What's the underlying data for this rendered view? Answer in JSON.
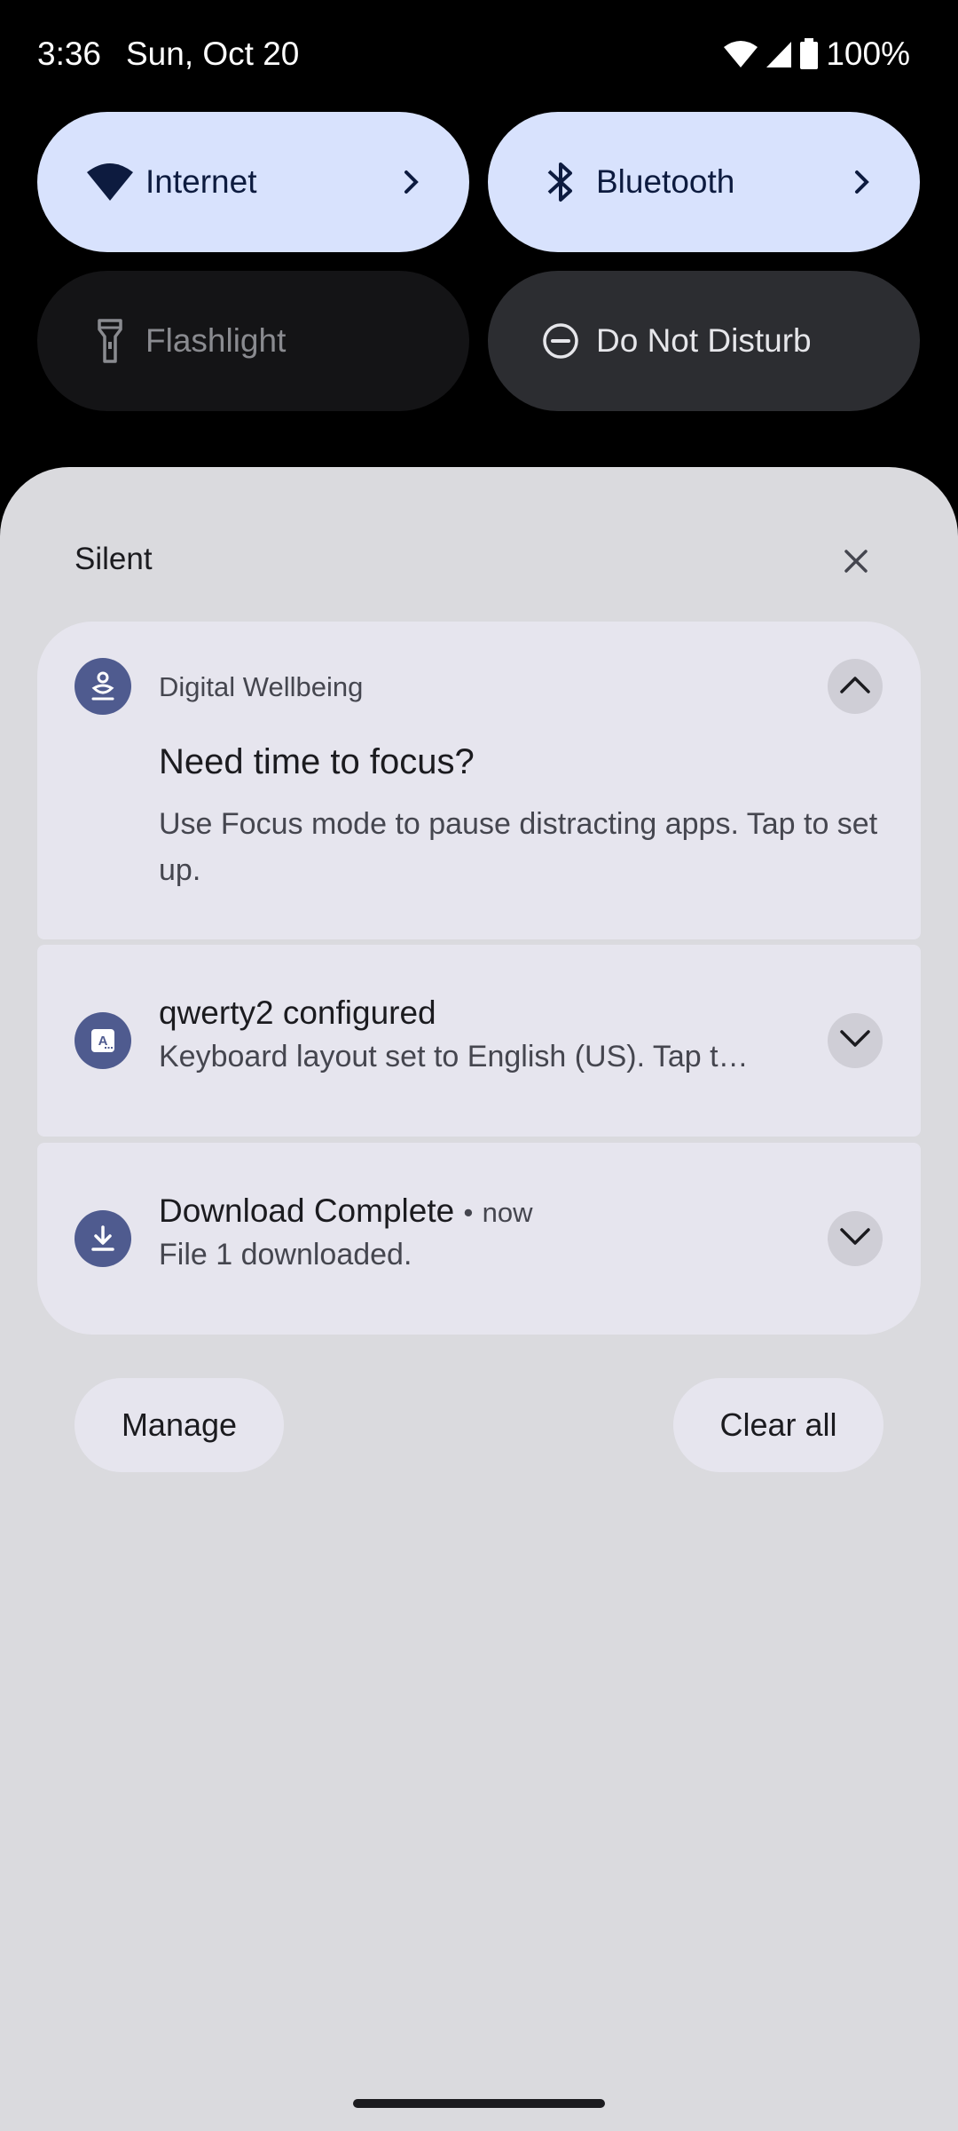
{
  "status_bar": {
    "time": "3:36",
    "date": "Sun, Oct 20",
    "battery": "100%"
  },
  "quick_tiles": [
    {
      "label": "Internet",
      "icon": "wifi-icon",
      "state": "on"
    },
    {
      "label": "Bluetooth",
      "icon": "bluetooth-icon",
      "state": "on"
    },
    {
      "label": "Flashlight",
      "icon": "flashlight-icon",
      "state": "unavailable"
    },
    {
      "label": "Do Not Disturb",
      "icon": "do-not-disturb-icon",
      "state": "off"
    }
  ],
  "shade": {
    "section_title": "Silent",
    "notifications": [
      {
        "app": "Digital Wellbeing",
        "icon": "wellbeing-icon",
        "title": "Need time to focus?",
        "text": "Use Focus mode to pause distracting apps. Tap to set up.",
        "expanded": true
      },
      {
        "title": "qwerty2 configured",
        "icon": "keyboard-icon",
        "text": "Keyboard layout set to English (US). Tap t…",
        "expanded": false
      },
      {
        "title": "Download Complete",
        "time": "now",
        "separator": "•",
        "icon": "download-icon",
        "text": "File 1 downloaded.",
        "expanded": false
      }
    ],
    "manage_label": "Manage",
    "clear_all_label": "Clear all"
  },
  "colors": {
    "tile_active": "#d8e2fd",
    "shade_bg": "#dadade",
    "card_bg": "#e6e5ee",
    "app_icon_bg": "#4f5b8f"
  }
}
